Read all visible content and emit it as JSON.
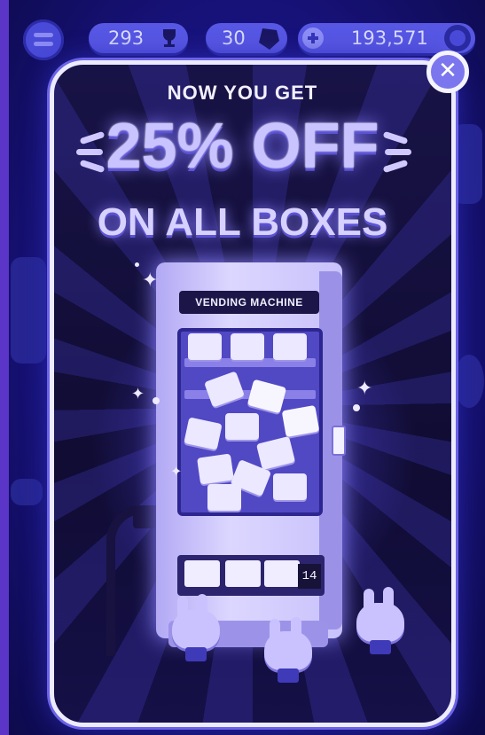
{
  "hud": {
    "trophies": "293",
    "gems": "30",
    "coins": "193,571"
  },
  "popup": {
    "line1": "NOW YOU GET",
    "line2": "25% OFF",
    "line3": "ON ALL BOXES"
  },
  "machine": {
    "label": "VENDING MACHINE",
    "counter": "14"
  },
  "colors": {
    "accent": "#7b76ee",
    "panel": "#100c33",
    "highlight": "#c9c3ff"
  },
  "icons": [
    "menu-icon",
    "trophy-icon",
    "gem-icon",
    "coin-add-icon",
    "sponsor-badge-icon",
    "close-icon",
    "sparkle-icon"
  ]
}
